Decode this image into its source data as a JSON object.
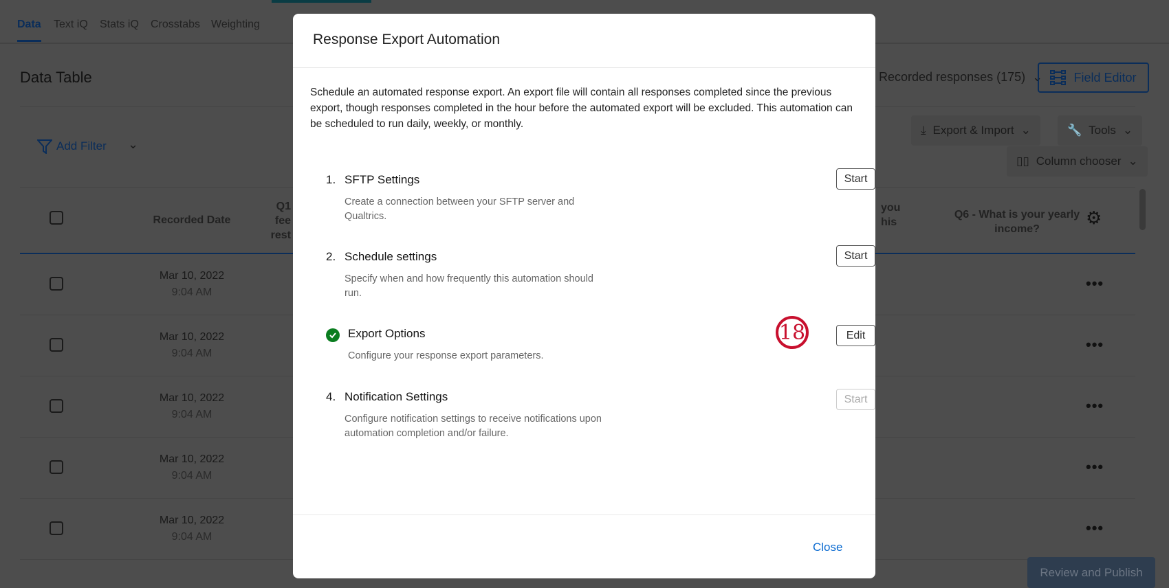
{
  "tabs": [
    {
      "label": "Data"
    },
    {
      "label": "Text iQ"
    },
    {
      "label": "Stats iQ"
    },
    {
      "label": "Crosstabs"
    },
    {
      "label": "Weighting"
    }
  ],
  "page_title": "Data Table",
  "responses_dropdown": "Recorded responses (175)",
  "field_editor": "Field Editor",
  "add_filter": "Add Filter",
  "export_import": "Export & Import",
  "tools": "Tools",
  "column_chooser": "Column chooser",
  "table": {
    "headers": {
      "recorded_date": "Recorded Date",
      "q1_fragments": [
        "Q1",
        "fee",
        "rest"
      ],
      "q5_fragments": [
        "you",
        "his"
      ],
      "q6": "Q6 - What is your yearly income?"
    },
    "rows": [
      {
        "date": "Mar 10, 2022",
        "time": "9:04 AM"
      },
      {
        "date": "Mar 10, 2022",
        "time": "9:04 AM"
      },
      {
        "date": "Mar 10, 2022",
        "time": "9:04 AM"
      },
      {
        "date": "Mar 10, 2022",
        "time": "9:04 AM"
      },
      {
        "date": "Mar 10, 2022",
        "time": "9:04 AM"
      }
    ]
  },
  "review_publish": "Review and Publish",
  "modal": {
    "title": "Response Export Automation",
    "description": "Schedule an automated response export. An export file will contain all responses completed since the previous export, though responses completed in the hour before the automated export will be excluded. This automation can be scheduled to run daily, weekly, or monthly.",
    "steps": [
      {
        "number": "1.",
        "title": "SFTP Settings",
        "desc": "Create a connection between your SFTP server and Qualtrics.",
        "button": "Start",
        "state": "enabled"
      },
      {
        "number": "2.",
        "title": "Schedule settings",
        "desc": "Specify when and how frequently this automation should run.",
        "button": "Start",
        "state": "enabled"
      },
      {
        "number": "",
        "title": "Export Options",
        "desc": "Configure your response export parameters.",
        "button": "Edit",
        "state": "complete"
      },
      {
        "number": "4.",
        "title": "Notification Settings",
        "desc": "Configure notification settings to receive notifications upon automation completion and/or failure.",
        "button": "Start",
        "state": "disabled"
      }
    ],
    "close": "Close"
  },
  "annotation_badge": "18",
  "colors": {
    "accent": "#0b4ea2",
    "success": "#0a7d1f",
    "annotation": "#c8102e",
    "link": "#0b6bd1"
  }
}
